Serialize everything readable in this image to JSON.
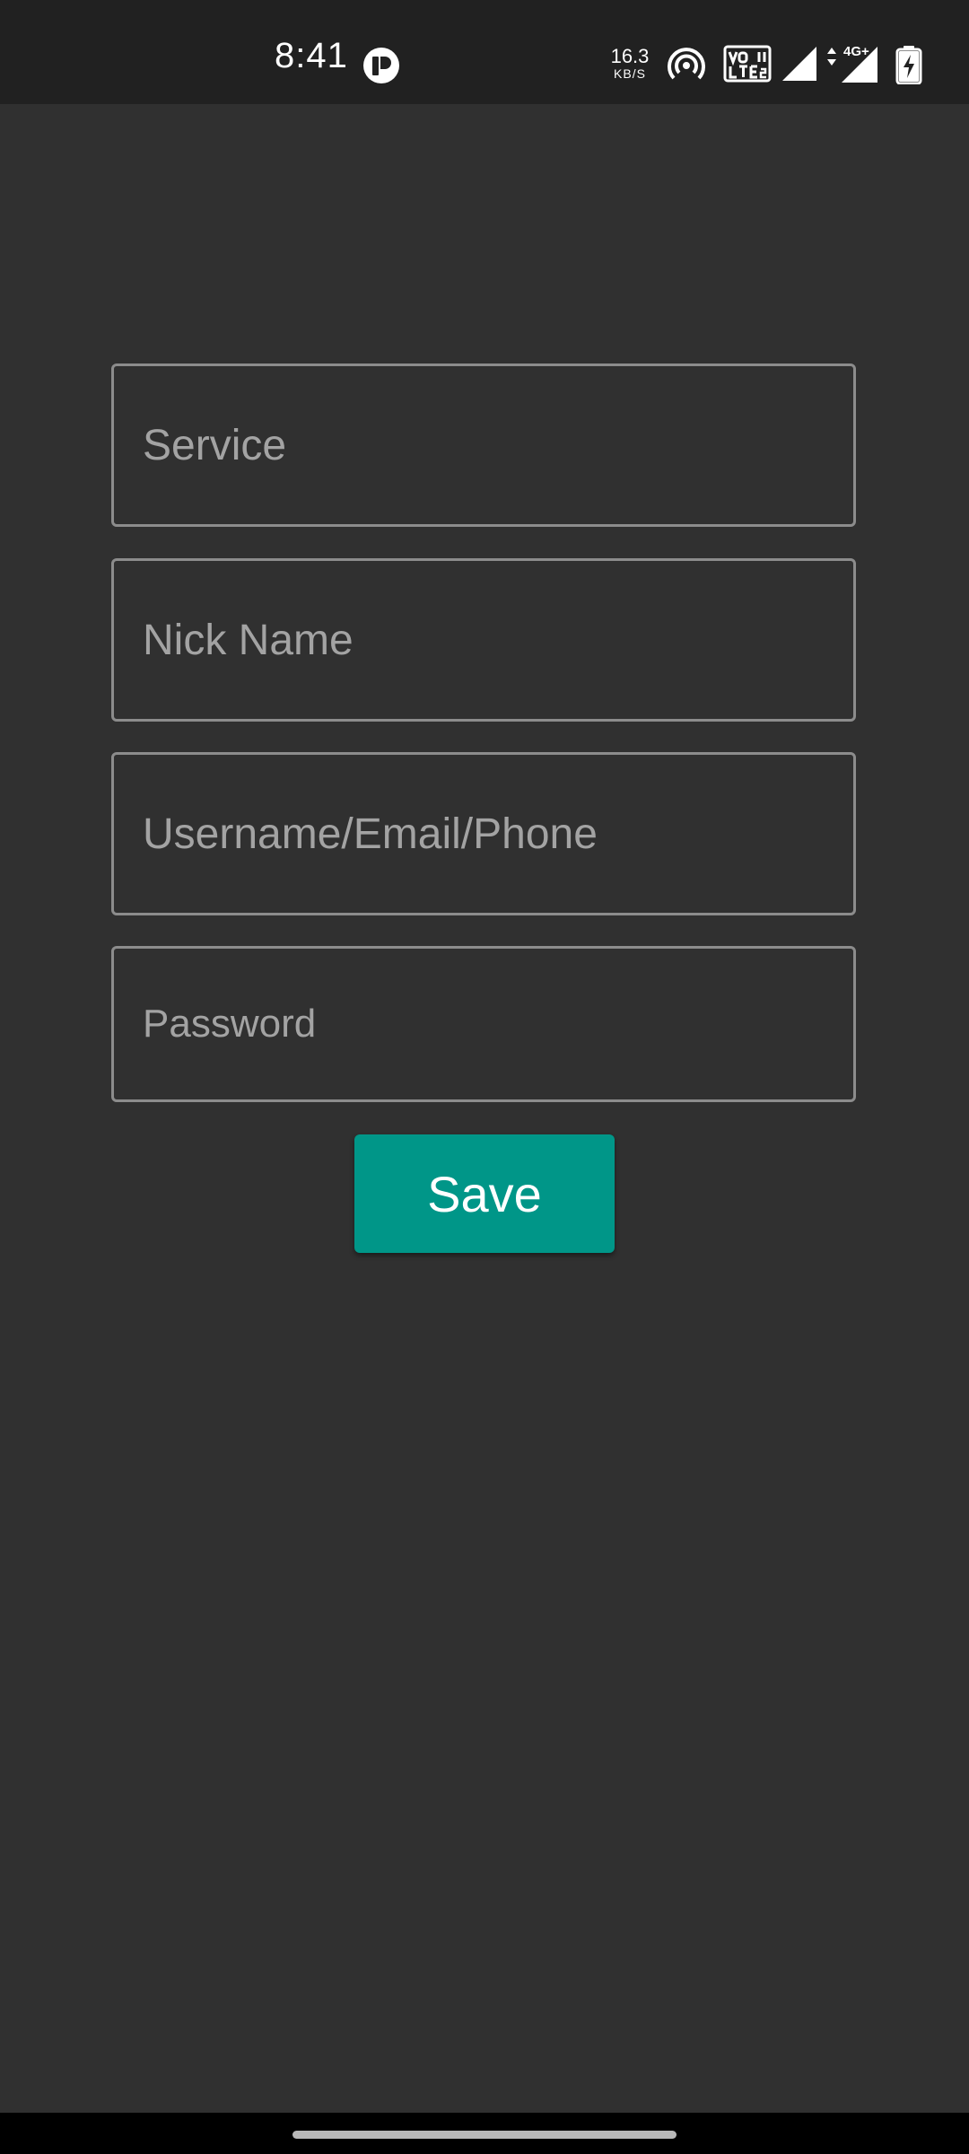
{
  "status_bar": {
    "time": "8:41",
    "network_speed_value": "16.3",
    "network_speed_unit": "KB/S",
    "icons": [
      "app-notification-icon",
      "hotspot-icon",
      "volte-icon",
      "signal-icon",
      "signal-4g-icon",
      "battery-charging-icon"
    ]
  },
  "form": {
    "service": {
      "placeholder": "Service",
      "value": ""
    },
    "nickname": {
      "placeholder": "Nick Name",
      "value": ""
    },
    "username": {
      "placeholder": "Username/Email/Phone",
      "value": ""
    },
    "password": {
      "placeholder": "Password",
      "value": ""
    },
    "save_label": "Save"
  },
  "colors": {
    "background": "#303030",
    "status_bar": "#212121",
    "accent": "#009688",
    "field_border": "#8c8c8c",
    "placeholder": "#a3a3a3"
  }
}
